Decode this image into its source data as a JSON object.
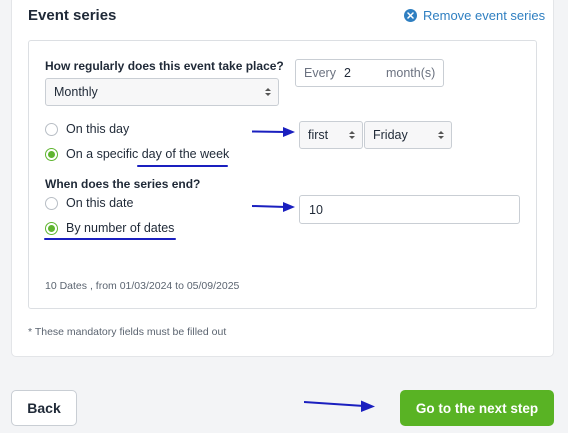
{
  "section": {
    "title": "Event series",
    "remove_label": "Remove event series"
  },
  "frequency": {
    "question": "How regularly does this event take place?",
    "selected": "Monthly",
    "every_prefix": "Every",
    "every_value": "2",
    "every_unit": "month(s)"
  },
  "day_options": {
    "on_this_day_label": "On this day",
    "specific_prefix": "On a specific ",
    "specific_highlight": "day of the week",
    "selected_option": "specific",
    "ordinal_selected": "first",
    "weekday_selected": "Friday"
  },
  "series_end": {
    "question": "When does the series end?",
    "on_date_label": "On this date",
    "by_number_label": "By number of dates",
    "selected_option": "by_number",
    "number_value": "10"
  },
  "summary": "10 Dates , from 01/03/2024 to 05/09/2025",
  "footnote": "* These mandatory fields must be filled out",
  "buttons": {
    "back": "Back",
    "next": "Go to the next step"
  },
  "colors": {
    "accent_green": "#59b324",
    "link_blue": "#2f7fc1",
    "annotation_blue": "#1a1fbf"
  },
  "icons": {
    "remove": "close-circle-icon",
    "select": "select-arrows-icon",
    "annotation": "arrow-right-icon"
  }
}
